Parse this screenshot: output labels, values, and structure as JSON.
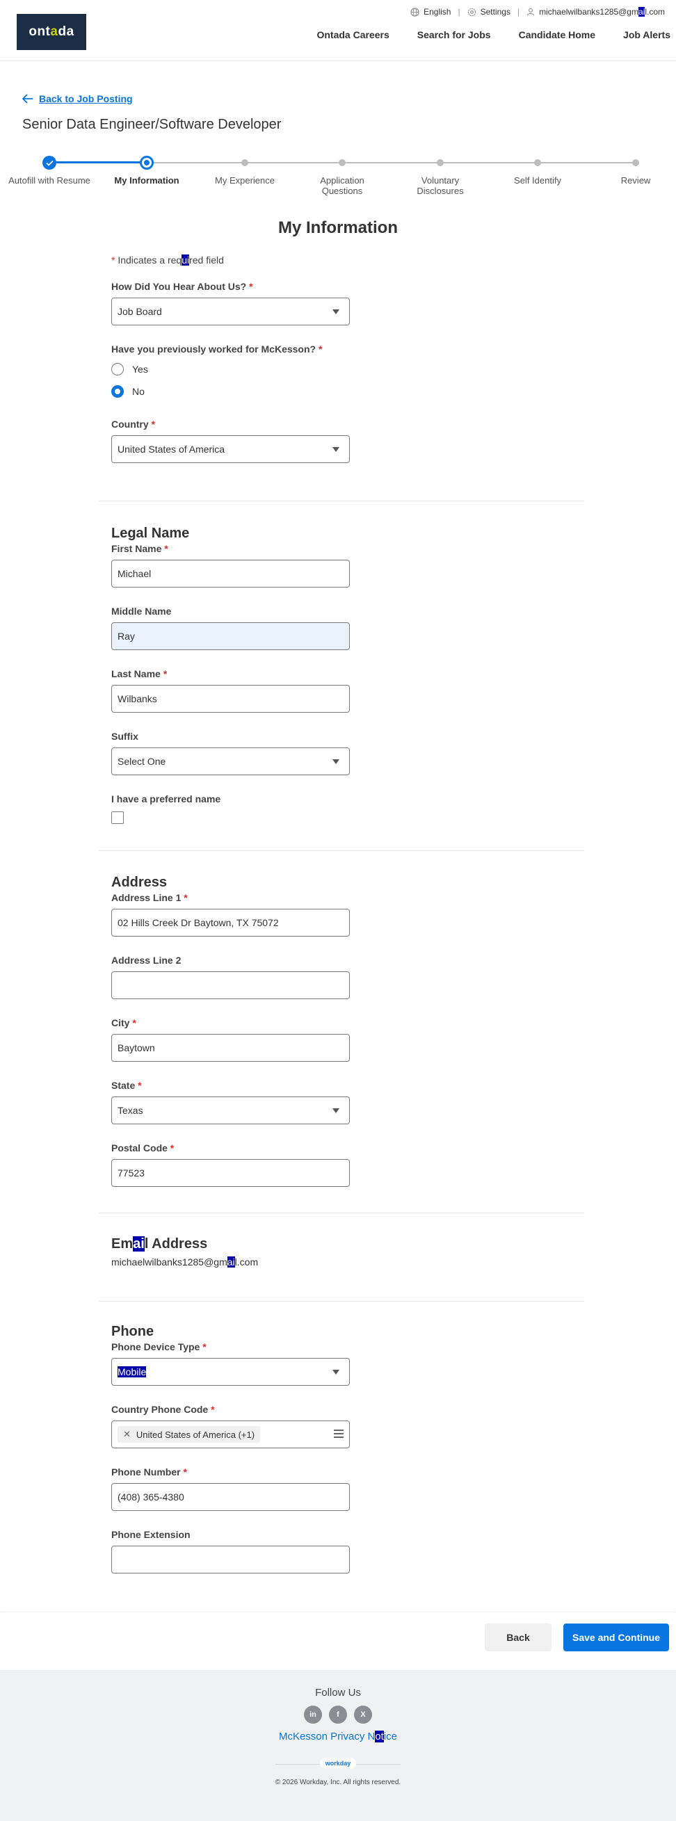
{
  "header": {
    "logo_text_1": "ont",
    "logo_text_2": "a",
    "logo_text_3": "da",
    "language": "English",
    "settings": "Settings",
    "account_email_pre": "michaelwilbanks1285@gm",
    "account_email_hl": "ai",
    "account_email_post": "l.com",
    "nav": [
      "Ontada Careers",
      "Search for Jobs",
      "Candidate Home",
      "Job Alerts"
    ]
  },
  "back_link": "Back to Job Posting",
  "job_title": "Senior Data Engineer/Software Developer",
  "stepper": {
    "steps": [
      {
        "label": "Autofill with Resume",
        "state": "done"
      },
      {
        "label": "My Information",
        "state": "current"
      },
      {
        "label": "My Experience",
        "state": "todo"
      },
      {
        "label": "Application Questions",
        "state": "todo"
      },
      {
        "label": "Voluntary Disclosures",
        "state": "todo"
      },
      {
        "label": "Self Identify",
        "state": "todo"
      },
      {
        "label": "Review",
        "state": "todo"
      }
    ]
  },
  "page_heading": "My Information",
  "required_note": {
    "star": "*",
    "pre": " Indicates a req",
    "hl": "ui",
    "post": "red field"
  },
  "source": {
    "label": "How Did You Hear About Us?",
    "value": "Job Board"
  },
  "previous": {
    "label": "Have you previously worked for McKesson?",
    "options": [
      "Yes",
      "No"
    ],
    "selected": "No"
  },
  "country": {
    "label": "Country",
    "value": "United States of America"
  },
  "legal_name": {
    "heading": "Legal Name",
    "first_label": "First Name",
    "first_value": "Michael",
    "middle_label": "Middle Name",
    "middle_value": "Ray",
    "last_label": "Last Name",
    "last_value": "Wilbanks",
    "suffix_label": "Suffix",
    "suffix_value": "Select One",
    "preferred_label": "I have a preferred name"
  },
  "address": {
    "heading": "Address",
    "line1_label": "Address Line 1",
    "line1_value": "02 Hills Creek Dr Baytown, TX 75072",
    "line2_label": "Address Line 2",
    "line2_value": "",
    "city_label": "City",
    "city_value": "Baytown",
    "state_label": "State",
    "state_value": "Texas",
    "postal_label": "Postal Code",
    "postal_value": "77523"
  },
  "email": {
    "heading_pre": "Em",
    "heading_hl": "ai",
    "heading_post": "l Address",
    "value_pre": "michaelwilbanks1285@gm",
    "value_hl": "ai",
    "value_post": "l.com"
  },
  "phone": {
    "heading": "Phone",
    "device_label": "Phone Device Type",
    "device_value": "Mobile",
    "code_label": "Country Phone Code",
    "code_value": "United States of America (+1)",
    "number_label": "Phone Number",
    "number_value": "(408) 365-4380",
    "ext_label": "Phone Extension",
    "ext_value": ""
  },
  "buttons": {
    "back": "Back",
    "save": "Save and Continue"
  },
  "footer": {
    "follow": "Follow Us",
    "socials": [
      "in",
      "f",
      "X"
    ],
    "privacy_pre": "McKesson Privacy N",
    "privacy_hl": "ot",
    "privacy_post": "ice",
    "workday": "workday",
    "copyright": "© 2026 Workday, Inc. All rights reserved."
  },
  "colors": {
    "accent": "#0875e1",
    "required": "#de2b2b",
    "logo_bg": "#1b2d45"
  }
}
